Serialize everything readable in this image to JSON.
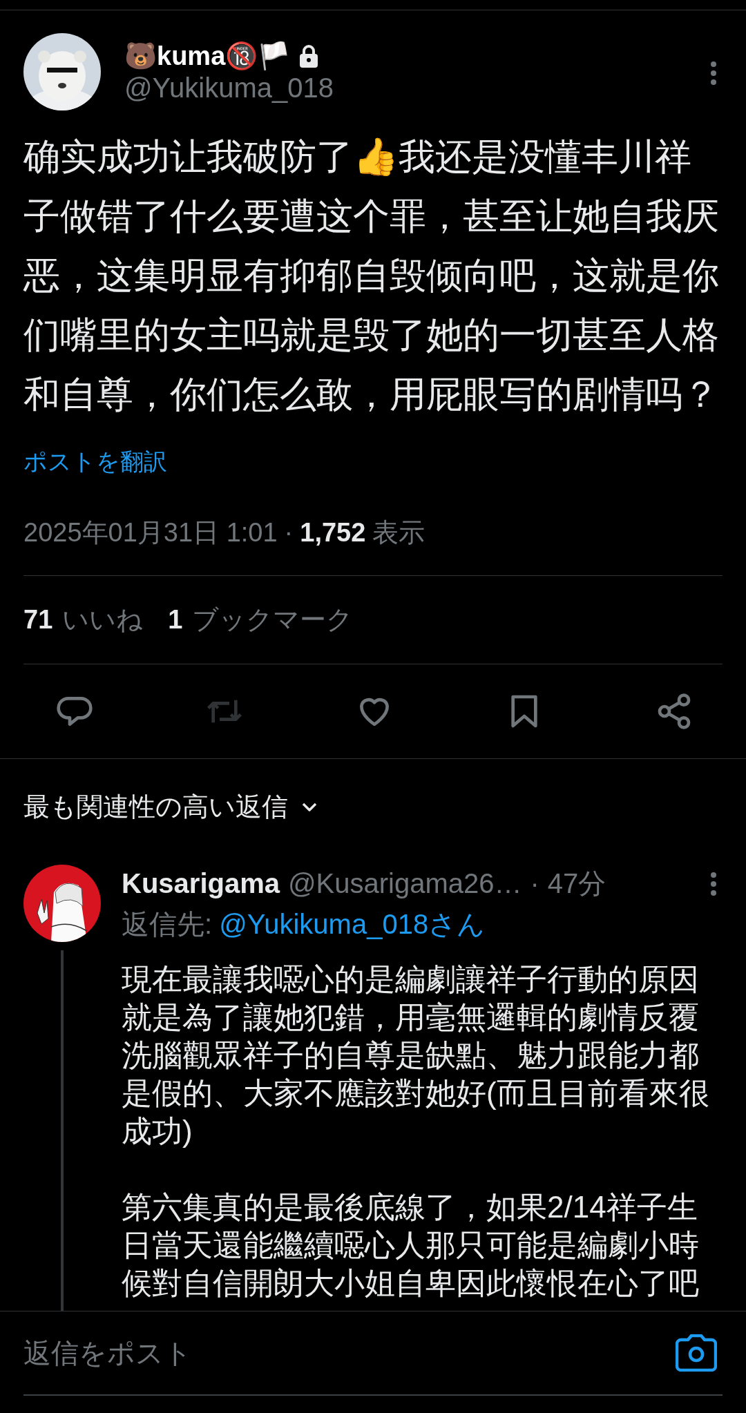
{
  "post": {
    "display_name": "🐻kuma🔞🏳️",
    "protected": true,
    "handle": "@Yukikuma_018",
    "text": "确实成功让我破防了👍我还是没懂丰川祥子做错了什么要遭这个罪，甚至让她自我厌恶，这集明显有抑郁自毁倾向吧，这就是你们嘴里的女主吗就是毁了她的一切甚至人格和自尊，你们怎么敢，用屁眼写的剧情吗？",
    "translate_link": "ポストを翻訳",
    "timestamp": "2025年01月31日 1:01",
    "separator": "·",
    "views": "1,752",
    "views_label": "表示",
    "stats": [
      {
        "count": "71",
        "label": "いいね"
      },
      {
        "count": "1",
        "label": "ブックマーク"
      }
    ],
    "actions": [
      {
        "kind": "reply",
        "disabled": false
      },
      {
        "kind": "repost",
        "disabled": true
      },
      {
        "kind": "like",
        "disabled": false
      },
      {
        "kind": "bookmark",
        "disabled": false
      },
      {
        "kind": "share",
        "disabled": false
      }
    ]
  },
  "replies_heading": "最も関連性の高い返信",
  "replies": [
    {
      "display_name": "Kusarigama",
      "handle": "@Kusarigama26…",
      "separator": "·",
      "time": "47分",
      "reply_to_label": "返信先:",
      "reply_to": "@Yukikuma_018さん",
      "text": "現在最讓我噁心的是編劇讓祥子行動的原因就是為了讓她犯錯，用毫無邏輯的劇情反覆洗腦觀眾祥子的自尊是缺點、魅力跟能力都是假的、大家不應該對她好(而且目前看來很成功)\n\n第六集真的是最後底線了，如果2/14祥子生日當天還能繼續噁心人那只可能是編劇小時候對自信開朗大小姐自卑因此懷恨在心了吧"
    }
  ],
  "reply_box": {
    "placeholder": "返信をポスト"
  }
}
